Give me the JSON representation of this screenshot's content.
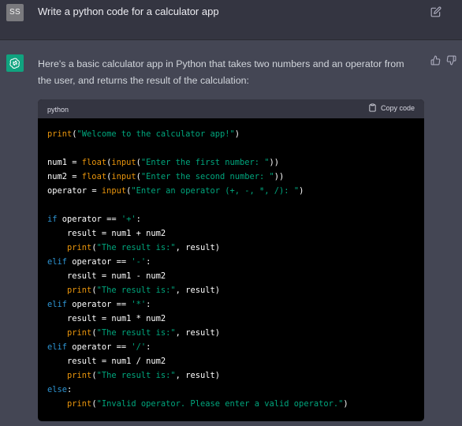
{
  "user_message": {
    "avatar_initials": "SS",
    "text": "Write a python code for a calculator app",
    "edit_icon": "edit-icon"
  },
  "assistant_message": {
    "avatar_icon": "openai-logo-icon",
    "intro": "Here's a basic calculator app in Python that takes two numbers and an operator from the user, and returns the result of the calculation:",
    "feedback_icons": [
      "thumbs-up-icon",
      "thumbs-down-icon"
    ]
  },
  "code_block": {
    "language": "python",
    "copy_label": "Copy code",
    "lines": [
      [
        [
          "bi",
          "print"
        ],
        [
          "op",
          "("
        ],
        [
          "st",
          "\"Welcome to the calculator app!\""
        ],
        [
          "op",
          ")"
        ]
      ],
      [],
      [
        [
          "id",
          "num1 "
        ],
        [
          "op",
          "= "
        ],
        [
          "bi",
          "float"
        ],
        [
          "op",
          "("
        ],
        [
          "bi",
          "input"
        ],
        [
          "op",
          "("
        ],
        [
          "st",
          "\"Enter the first number: \""
        ],
        [
          "op",
          "))"
        ]
      ],
      [
        [
          "id",
          "num2 "
        ],
        [
          "op",
          "= "
        ],
        [
          "bi",
          "float"
        ],
        [
          "op",
          "("
        ],
        [
          "bi",
          "input"
        ],
        [
          "op",
          "("
        ],
        [
          "st",
          "\"Enter the second number: \""
        ],
        [
          "op",
          "))"
        ]
      ],
      [
        [
          "id",
          "operator "
        ],
        [
          "op",
          "= "
        ],
        [
          "bi",
          "input"
        ],
        [
          "op",
          "("
        ],
        [
          "st",
          "\"Enter an operator (+, -, *, /): \""
        ],
        [
          "op",
          ")"
        ]
      ],
      [],
      [
        [
          "kw",
          "if "
        ],
        [
          "id",
          "operator "
        ],
        [
          "op",
          "== "
        ],
        [
          "st",
          "'+'"
        ],
        [
          "op",
          ":"
        ]
      ],
      [
        [
          "id",
          "    result "
        ],
        [
          "op",
          "= "
        ],
        [
          "id",
          "num1 "
        ],
        [
          "op",
          "+ "
        ],
        [
          "id",
          "num2"
        ]
      ],
      [
        [
          "id",
          "    "
        ],
        [
          "bi",
          "print"
        ],
        [
          "op",
          "("
        ],
        [
          "st",
          "\"The result is:\""
        ],
        [
          "op",
          ", "
        ],
        [
          "id",
          "result"
        ],
        [
          "op",
          ")"
        ]
      ],
      [
        [
          "kw",
          "elif "
        ],
        [
          "id",
          "operator "
        ],
        [
          "op",
          "== "
        ],
        [
          "st",
          "'-'"
        ],
        [
          "op",
          ":"
        ]
      ],
      [
        [
          "id",
          "    result "
        ],
        [
          "op",
          "= "
        ],
        [
          "id",
          "num1 "
        ],
        [
          "op",
          "- "
        ],
        [
          "id",
          "num2"
        ]
      ],
      [
        [
          "id",
          "    "
        ],
        [
          "bi",
          "print"
        ],
        [
          "op",
          "("
        ],
        [
          "st",
          "\"The result is:\""
        ],
        [
          "op",
          ", "
        ],
        [
          "id",
          "result"
        ],
        [
          "op",
          ")"
        ]
      ],
      [
        [
          "kw",
          "elif "
        ],
        [
          "id",
          "operator "
        ],
        [
          "op",
          "== "
        ],
        [
          "st",
          "'*'"
        ],
        [
          "op",
          ":"
        ]
      ],
      [
        [
          "id",
          "    result "
        ],
        [
          "op",
          "= "
        ],
        [
          "id",
          "num1 "
        ],
        [
          "op",
          "* "
        ],
        [
          "id",
          "num2"
        ]
      ],
      [
        [
          "id",
          "    "
        ],
        [
          "bi",
          "print"
        ],
        [
          "op",
          "("
        ],
        [
          "st",
          "\"The result is:\""
        ],
        [
          "op",
          ", "
        ],
        [
          "id",
          "result"
        ],
        [
          "op",
          ")"
        ]
      ],
      [
        [
          "kw",
          "elif "
        ],
        [
          "id",
          "operator "
        ],
        [
          "op",
          "== "
        ],
        [
          "st",
          "'/'"
        ],
        [
          "op",
          ":"
        ]
      ],
      [
        [
          "id",
          "    result "
        ],
        [
          "op",
          "= "
        ],
        [
          "id",
          "num1 "
        ],
        [
          "op",
          "/ "
        ],
        [
          "id",
          "num2"
        ]
      ],
      [
        [
          "id",
          "    "
        ],
        [
          "bi",
          "print"
        ],
        [
          "op",
          "("
        ],
        [
          "st",
          "\"The result is:\""
        ],
        [
          "op",
          ", "
        ],
        [
          "id",
          "result"
        ],
        [
          "op",
          ")"
        ]
      ],
      [
        [
          "kw",
          "else"
        ],
        [
          "op",
          ":"
        ]
      ],
      [
        [
          "id",
          "    "
        ],
        [
          "bi",
          "print"
        ],
        [
          "op",
          "("
        ],
        [
          "st",
          "\"Invalid operator. Please enter a valid operator.\""
        ],
        [
          "op",
          ")"
        ]
      ]
    ]
  },
  "colors": {
    "page_bg": "#444654",
    "user_row_bg": "#343541",
    "code_bg": "#000000",
    "code_header_bg": "#343541",
    "avatar_gpt": "#10a37f",
    "keyword": "#2e95d3",
    "builtin": "#e9950c",
    "string": "#00a67d"
  }
}
